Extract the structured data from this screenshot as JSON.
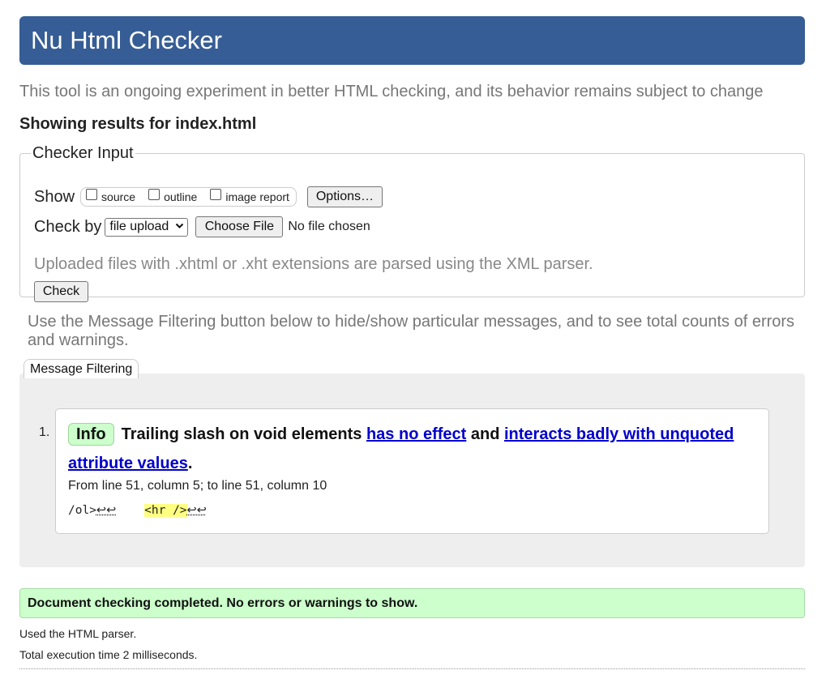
{
  "header": {
    "title": "Nu Html Checker"
  },
  "tagline": "This tool is an ongoing experiment in better HTML checking, and its behavior remains subject to change",
  "showing_results": "Showing results for index.html",
  "checker_input": {
    "legend": "Checker Input",
    "show_label": "Show",
    "show_options": [
      {
        "label": "source",
        "checked": false
      },
      {
        "label": "outline",
        "checked": false
      },
      {
        "label": "image report",
        "checked": false
      }
    ],
    "options_button": "Options…",
    "check_by_label": "Check by",
    "check_by_value": "file upload",
    "choose_file_button": "Choose File",
    "no_file_text": "No file chosen",
    "xml_note": "Uploaded files with .xhtml or .xht extensions are parsed using the XML parser.",
    "check_button": "Check"
  },
  "filter_note": "Use the Message Filtering button below to hide/show particular messages, and to see total counts of errors and warnings.",
  "message_filtering_button": "Message Filtering",
  "messages": [
    {
      "number": "1.",
      "type": "Info",
      "text_start": "Trailing slash on void elements ",
      "link1": "has no effect",
      "text_mid": " and ",
      "link2": "interacts badly with unquoted attribute values",
      "text_end": ".",
      "location": "From line 51, column 5; to line 51, column 10",
      "extract_before": "/ol>",
      "extract_gap": "    ",
      "extract_highlight": "<hr />",
      "linefeed_glyph": "↩↩"
    }
  ],
  "status": "Document checking completed. No errors or warnings to show.",
  "details": {
    "parser": "Used the HTML parser.",
    "time": "Total execution time 2 milliseconds."
  },
  "colors": {
    "header_bg": "#365d95",
    "info_badge_bg": "#ccffcc",
    "success_bg": "#ccffcc",
    "highlight": "#ffff80",
    "link": "#0000cc"
  }
}
